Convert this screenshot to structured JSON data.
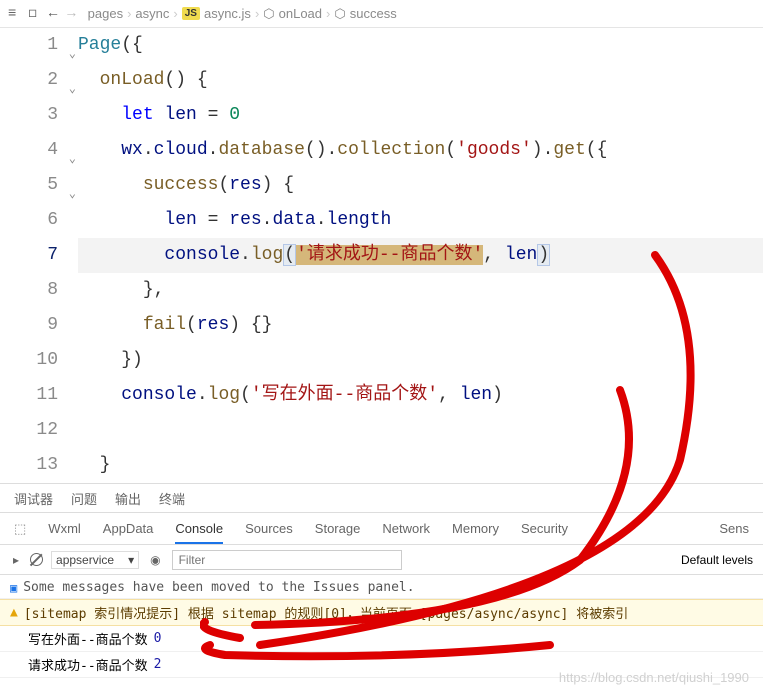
{
  "breadcrumb": [
    "pages",
    "async",
    "async.js",
    "onLoad",
    "success"
  ],
  "code_lines": 13,
  "highlighted_line": 7,
  "foldable_lines": [
    1,
    2,
    4,
    5
  ],
  "tokens": {
    "l1_page": "Page",
    "l2_onload": "onLoad",
    "l3_let": "let",
    "l3_len": "len",
    "l3_eq": "=",
    "l3_zero": "0",
    "l4_wx": "wx",
    "l4_cloud": "cloud",
    "l4_database": "database",
    "l4_collection": "collection",
    "l4_goods": "'goods'",
    "l4_get": "get",
    "l5_success": "success",
    "l5_res": "res",
    "l6_len": "len",
    "l6_res": "res",
    "l6_data": "data",
    "l6_length": "length",
    "l7_console": "console",
    "l7_log": "log",
    "l7_str": "'请求成功--商品个数'",
    "l7_len": "len",
    "l9_fail": "fail",
    "l9_res": "res",
    "l11_console": "console",
    "l11_log": "log",
    "l11_str": "'写在外面--商品个数'",
    "l11_len": "len"
  },
  "tabs_row": [
    "调试器",
    "问题",
    "输出",
    "终端"
  ],
  "dev_tabs": [
    "Wxml",
    "AppData",
    "Console",
    "Sources",
    "Storage",
    "Network",
    "Memory",
    "Security",
    "Sens"
  ],
  "dev_active": "Console",
  "filter": {
    "context": "appservice",
    "placeholder": "Filter",
    "levels": "Default levels"
  },
  "console": {
    "info": "Some messages have been moved to the Issues panel.",
    "warn": "[sitemap 索引情况提示] 根据 sitemap 的规则[0]，当前页面 [pages/async/async] 将被索引",
    "log1_text": "写在外面--商品个数",
    "log1_val": "0",
    "log2_text": "请求成功--商品个数",
    "log2_val": "2"
  },
  "watermark": "https://blog.csdn.net/qiushi_1990"
}
